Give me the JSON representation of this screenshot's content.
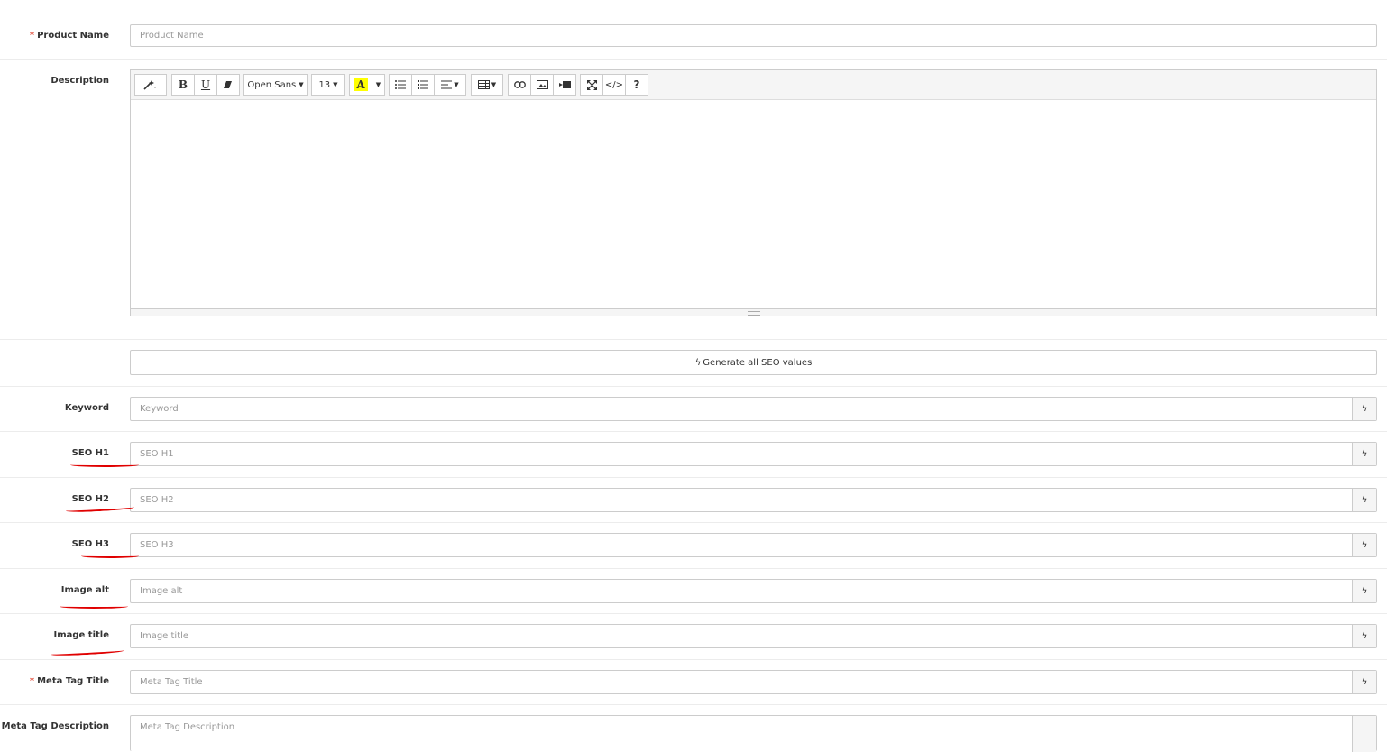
{
  "fields": {
    "product_name": {
      "label": "Product Name",
      "required_mark": "*",
      "placeholder": "Product Name"
    },
    "description": {
      "label": "Description"
    },
    "keyword": {
      "label": "Keyword",
      "placeholder": "Keyword"
    },
    "seo_h1": {
      "label": "SEO H1",
      "placeholder": "SEO H1"
    },
    "seo_h2": {
      "label": "SEO H2",
      "placeholder": "SEO H2"
    },
    "seo_h3": {
      "label": "SEO H3",
      "placeholder": "SEO H3"
    },
    "image_alt": {
      "label": "Image alt",
      "placeholder": "Image alt"
    },
    "image_title": {
      "label": "Image title",
      "placeholder": "Image title"
    },
    "meta_title": {
      "label": "Meta Tag Title",
      "required_mark": "*",
      "placeholder": "Meta Tag Title"
    },
    "meta_description": {
      "label": "Meta Tag Description",
      "placeholder": "Meta Tag Description"
    }
  },
  "editor_toolbar": {
    "font_family": "Open Sans",
    "font_size": "13",
    "highlight_letter": "A",
    "bold": "B",
    "underline": "U",
    "help": "?",
    "code": "</>"
  },
  "generate_button": {
    "label": "Generate all SEO values"
  },
  "colors": {
    "required": "#e3503e",
    "annotation": "#e00000",
    "highlight": "#ffff00"
  },
  "icons": {
    "magic": "magic-wand-icon",
    "eraser": "eraser-icon",
    "bolt": "bolt-icon",
    "ul": "unordered-list-icon",
    "ol": "ordered-list-icon",
    "align": "align-icon",
    "table": "table-icon",
    "link": "link-icon",
    "image": "image-icon",
    "video": "video-icon",
    "fullscreen": "fullscreen-icon"
  }
}
